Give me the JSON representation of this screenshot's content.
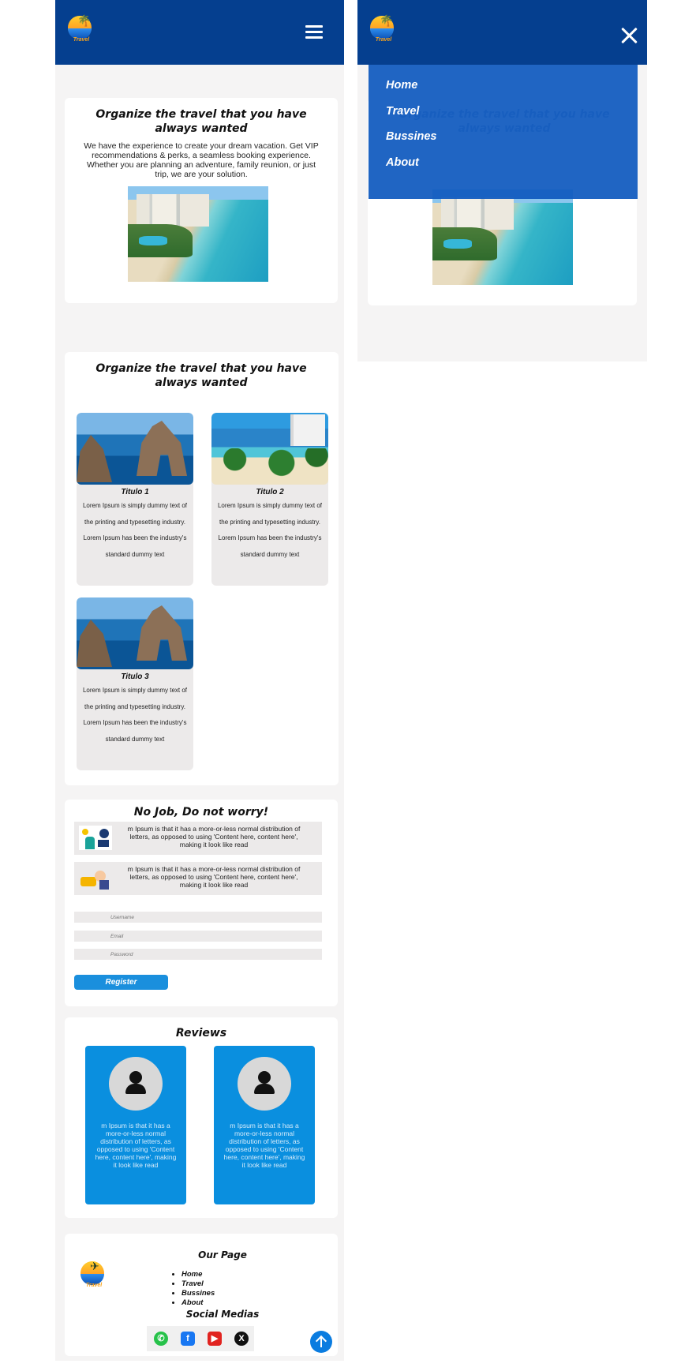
{
  "brand": {
    "logo_text": "Travel"
  },
  "hero": {
    "title": "Organize the travel that you have always wanted",
    "text": "We have the experience to create your dream vacation. Get VIP recommendations & perks, a seamless booking experience. Whether you are planning an adventure, family reunion, or just trip, we are your solution."
  },
  "destinations": {
    "title": "Organize the travel that you have always wanted",
    "items": [
      {
        "name": "Titulo 1",
        "desc": "Lorem Ipsum is simply dummy text of the printing and typesetting industry. Lorem Ipsum has been the industry's standard dummy text"
      },
      {
        "name": "Titulo 2",
        "desc": "Lorem Ipsum is simply dummy text of the printing and typesetting industry. Lorem Ipsum has been the industry's standard dummy text"
      },
      {
        "name": "Titulo 3",
        "desc": "Lorem Ipsum is simply dummy text of the printing and typesetting industry. Lorem Ipsum has been the industry's standard dummy text"
      }
    ]
  },
  "jobs": {
    "title": "No Job, Do not worry!",
    "rows": [
      {
        "text": "m Ipsum is that it has a more-or-less normal distribution of letters, as  opposed to using 'Content here, content here', making it look like read"
      },
      {
        "text": "m Ipsum is that it has a more-or-less normal distribution of letters, as  opposed to using 'Content here, content here', making it look like read"
      }
    ],
    "form": {
      "username_placeholder": "Username",
      "email_placeholder": "Email",
      "password_placeholder": "Password",
      "register_label": "Register"
    }
  },
  "reviews": {
    "title": "Reviews",
    "items": [
      {
        "text": "m Ipsum is that it has a more-or-less normal distribution of letters, as opposed to using 'Content here, content here', making it look like read"
      },
      {
        "text": "m Ipsum is that it has a more-or-less normal distribution of letters, as opposed to using 'Content here, content here', making it look like read"
      }
    ]
  },
  "footer": {
    "our_page_title": "Our Page",
    "links": [
      "Home",
      "Travel",
      "Bussines",
      "About"
    ],
    "social_title": "Social Medias",
    "socials": [
      "whatsapp-icon",
      "facebook-icon",
      "youtube-icon",
      "x-icon"
    ]
  },
  "menu": {
    "items": [
      "Home",
      "Travel",
      "Bussines",
      "About"
    ]
  },
  "colors": {
    "header": "#053f8f",
    "menu_overlay": "#0f59be",
    "accent_blue": "#0a8fdf",
    "page_bg": "#f5f4f4"
  }
}
